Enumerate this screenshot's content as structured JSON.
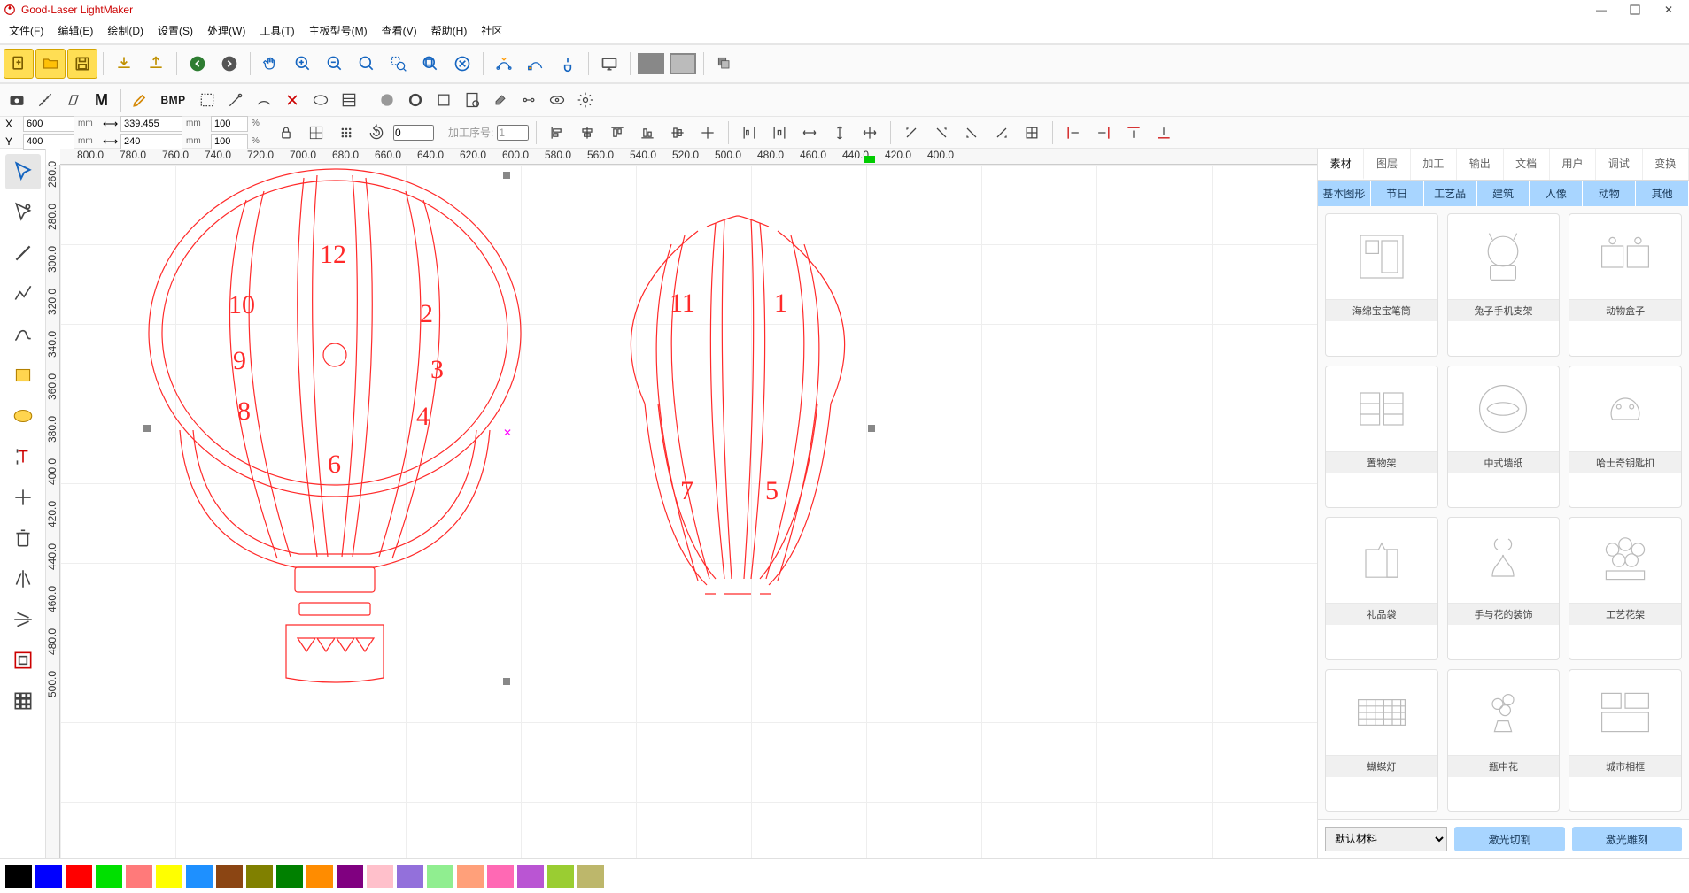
{
  "app": {
    "title": "Good-Laser LightMaker"
  },
  "menu": {
    "items": [
      "文件(F)",
      "编辑(E)",
      "绘制(D)",
      "设置(S)",
      "处理(W)",
      "工具(T)",
      "主板型号(M)",
      "查看(V)",
      "帮助(H)",
      "社区"
    ]
  },
  "toolbar2": {
    "bmp": "BMP"
  },
  "coords": {
    "xLabel": "X",
    "xVal": "600",
    "xUnit": "mm",
    "yLabel": "Y",
    "yVal": "400",
    "yUnit": "mm",
    "wVal": "339.455",
    "wUnit": "mm",
    "hVal": "240",
    "hUnit": "mm",
    "sxVal": "100",
    "syVal": "100",
    "sUnit": "%",
    "rotVal": "0",
    "jobLabel": "加工序号:",
    "jobVal": "1"
  },
  "rulerH": [
    "800.0",
    "780.0",
    "760.0",
    "740.0",
    "720.0",
    "700.0",
    "680.0",
    "660.0",
    "640.0",
    "620.0",
    "600.0",
    "580.0",
    "560.0",
    "540.0",
    "520.0",
    "500.0",
    "480.0",
    "460.0",
    "440.0",
    "420.0",
    "400.0"
  ],
  "rulerV": [
    "260.0",
    "280.0",
    "300.0",
    "320.0",
    "340.0",
    "360.0",
    "380.0",
    "400.0",
    "420.0",
    "440.0",
    "460.0",
    "480.0",
    "500.0"
  ],
  "balloon1Nums": {
    "n12": "12",
    "n10": "10",
    "n2": "2",
    "n9": "9",
    "n3": "3",
    "n8": "8",
    "n4": "4",
    "n6": "6"
  },
  "balloon2Nums": {
    "n11": "11",
    "n1": "1",
    "n7": "7",
    "n5": "5"
  },
  "rpanel": {
    "tabs": [
      "素材",
      "图层",
      "加工",
      "输出",
      "文档",
      "用户",
      "调试",
      "变换"
    ],
    "cats": [
      "基本图形",
      "节日",
      "工艺品",
      "建筑",
      "人像",
      "动物",
      "其他"
    ],
    "items": [
      "海绵宝宝笔筒",
      "兔子手机支架",
      "动物盒子",
      "置物架",
      "中式墙纸",
      "哈士奇钥匙扣",
      "礼品袋",
      "手与花的装饰",
      "工艺花架",
      "蝴蝶灯",
      "瓶中花",
      "城市相框"
    ],
    "material": "默认材料",
    "btnCut": "激光切割",
    "btnEngrave": "激光雕刻"
  },
  "palette": [
    "#000000",
    "#0000ff",
    "#ff0000",
    "#00e000",
    "#ff7a7a",
    "#ffff00",
    "#1e90ff",
    "#8b4513",
    "#808000",
    "#008000",
    "#ff8c00",
    "#800080",
    "#ffc0cb",
    "#9370db",
    "#90ee90",
    "#ffa07a",
    "#ff69b4",
    "#ba55d3",
    "#9acd32",
    "#bdb76b"
  ]
}
